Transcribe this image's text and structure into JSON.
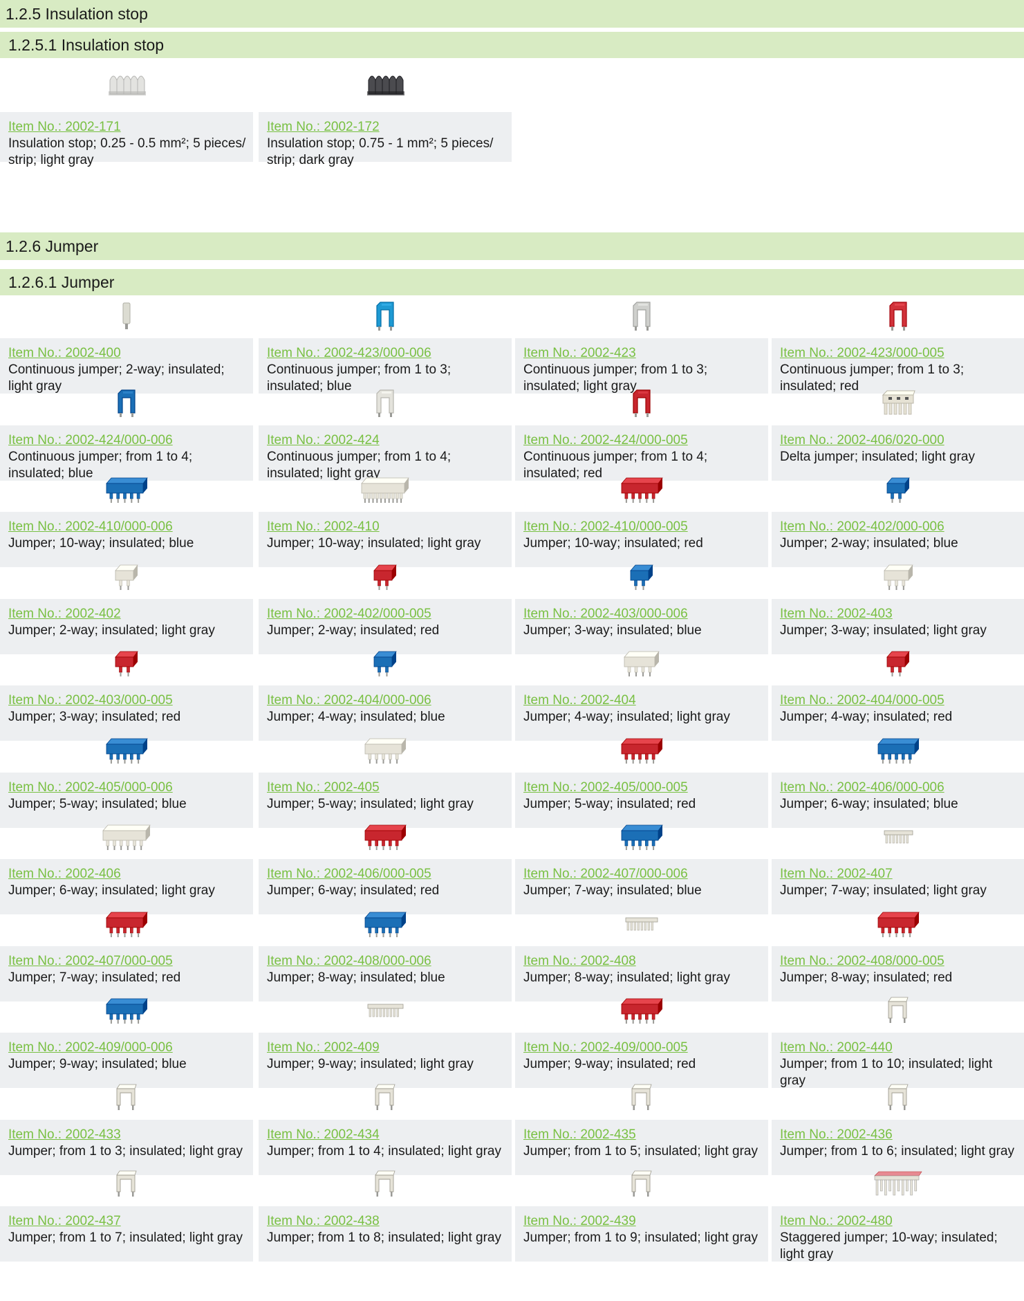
{
  "sections": {
    "s125": "1.2.5 Insulation stop",
    "s1251": "1.2.5.1 Insulation stop",
    "s126": "1.2.6 Jumper",
    "s1261": "1.2.6.1 Jumper"
  },
  "insulation_items": [
    {
      "item": "Item No.: 2002-171",
      "desc": "Insulation stop; 0.25 - 0.5 mm²; 5 pieces/ strip; light gray",
      "color": "#e3e3e0",
      "kind": "stop"
    },
    {
      "item": "Item No.: 2002-172",
      "desc": "Insulation stop; 0.75 - 1 mm²; 5 pieces/ strip; dark gray",
      "color": "#4b4b4f",
      "kind": "stop"
    }
  ],
  "jumper_items": [
    {
      "item": "Item No.: 2002-400",
      "desc": "Continuous jumper; 2-way; insulated; light gray",
      "color": "#dcdcd2",
      "kind": "single"
    },
    {
      "item": "Item No.: 2002-423/000-006",
      "desc": "Continuous jumper; from 1 to 3; insulated; blue",
      "color": "#1e9ad3",
      "kind": "cont"
    },
    {
      "item": "Item No.: 2002-423",
      "desc": "Continuous jumper; from 1 to 3; insulated; light gray",
      "color": "#cfd0cd",
      "kind": "cont"
    },
    {
      "item": "Item No.: 2002-423/000-005",
      "desc": "Continuous jumper; from 1 to 3; insulated; red",
      "color": "#d1323a",
      "kind": "cont"
    },
    {
      "item": "Item No.: 2002-424/000-006",
      "desc": "Continuous jumper; from 1 to 4; insulated; blue",
      "color": "#1b6fb6",
      "kind": "cont2"
    },
    {
      "item": "Item No.: 2002-424",
      "desc": "Continuous jumper; from 1 to 4; insulated; light gray",
      "color": "#e4e3dc",
      "kind": "cont2"
    },
    {
      "item": "Item No.: 2002-424/000-005",
      "desc": "Continuous jumper; from 1 to 4; insulated; red",
      "color": "#c8262e",
      "kind": "cont2"
    },
    {
      "item": "Item No.: 2002-406/020-000",
      "desc": "Delta jumper; insulated; light gray",
      "color": "#e6e2d4",
      "kind": "delta"
    },
    {
      "item": "Item No.: 2002-410/000-006",
      "desc": "Jumper; 10-way; insulated; blue",
      "color": "#1b6fb6",
      "kind": "multi",
      "n": 5
    },
    {
      "item": "Item No.: 2002-410",
      "desc": "Jumper; 10-way; insulated; light gray",
      "color": "#e6e3d8",
      "kind": "multi",
      "n": 10
    },
    {
      "item": "Item No.: 2002-410/000-005",
      "desc": "Jumper; 10-way; insulated; red",
      "color": "#c8262e",
      "kind": "multi",
      "n": 5
    },
    {
      "item": "Item No.: 2002-402/000-006",
      "desc": "Jumper; 2-way; insulated; blue",
      "color": "#1b6fb6",
      "kind": "multi",
      "n": 2
    },
    {
      "item": "Item No.: 2002-402",
      "desc": "Jumper; 2-way; insulated; light gray",
      "color": "#e6e3d8",
      "kind": "multi",
      "n": 2
    },
    {
      "item": "Item No.: 2002-402/000-005",
      "desc": "Jumper; 2-way; insulated; red",
      "color": "#c8262e",
      "kind": "multi",
      "n": 2
    },
    {
      "item": "Item No.: 2002-403/000-006",
      "desc": "Jumper; 3-way; insulated; blue",
      "color": "#1b6fb6",
      "kind": "multi",
      "n": 2
    },
    {
      "item": "Item No.: 2002-403",
      "desc": "Jumper; 3-way; insulated; light gray",
      "color": "#e6e3d8",
      "kind": "multi",
      "n": 3
    },
    {
      "item": "Item No.: 2002-403/000-005",
      "desc": "Jumper; 3-way; insulated; red",
      "color": "#c8262e",
      "kind": "multi",
      "n": 2
    },
    {
      "item": "Item No.: 2002-404/000-006",
      "desc": "Jumper; 4-way; insulated; blue",
      "color": "#1b6fb6",
      "kind": "multi",
      "n": 2
    },
    {
      "item": "Item No.: 2002-404",
      "desc": "Jumper; 4-way; insulated; light gray",
      "color": "#e6e3d8",
      "kind": "multi",
      "n": 4
    },
    {
      "item": "Item No.: 2002-404/000-005",
      "desc": "Jumper; 4-way; insulated; red",
      "color": "#c8262e",
      "kind": "multi",
      "n": 2
    },
    {
      "item": "Item No.: 2002-405/000-006",
      "desc": "Jumper; 5-way; insulated; blue",
      "color": "#1b6fb6",
      "kind": "multi",
      "n": 5
    },
    {
      "item": "Item No.: 2002-405",
      "desc": "Jumper; 5-way; insulated; light gray",
      "color": "#e6e3d8",
      "kind": "multi",
      "n": 5
    },
    {
      "item": "Item No.: 2002-405/000-005",
      "desc": "Jumper; 5-way; insulated; red",
      "color": "#c8262e",
      "kind": "multi",
      "n": 5
    },
    {
      "item": "Item No.: 2002-406/000-006",
      "desc": "Jumper; 6-way; insulated; blue",
      "color": "#1b6fb6",
      "kind": "multi",
      "n": 5
    },
    {
      "item": "Item No.: 2002-406",
      "desc": "Jumper; 6-way; insulated; light gray",
      "color": "#e6e3d8",
      "kind": "multi",
      "n": 6
    },
    {
      "item": "Item No.: 2002-406/000-005",
      "desc": "Jumper; 6-way; insulated; red",
      "color": "#c8262e",
      "kind": "multi",
      "n": 5
    },
    {
      "item": "Item No.: 2002-407/000-006",
      "desc": "Jumper; 7-way; insulated; blue",
      "color": "#1b6fb6",
      "kind": "multi",
      "n": 5
    },
    {
      "item": "Item No.: 2002-407",
      "desc": "Jumper; 7-way; insulated; light gray",
      "color": "#e6e3d8",
      "kind": "comb",
      "n": 7
    },
    {
      "item": "Item No.: 2002-407/000-005",
      "desc": "Jumper; 7-way; insulated; red",
      "color": "#c8262e",
      "kind": "multi",
      "n": 5
    },
    {
      "item": "Item No.: 2002-408/000-006",
      "desc": "Jumper; 8-way; insulated; blue",
      "color": "#1b6fb6",
      "kind": "multi",
      "n": 5
    },
    {
      "item": "Item No.: 2002-408",
      "desc": "Jumper; 8-way; insulated; light gray",
      "color": "#e6e3d8",
      "kind": "comb",
      "n": 8
    },
    {
      "item": "Item No.: 2002-408/000-005",
      "desc": "Jumper; 8-way; insulated; red",
      "color": "#c8262e",
      "kind": "multi",
      "n": 5
    },
    {
      "item": "Item No.: 2002-409/000-006",
      "desc": "Jumper; 9-way; insulated; blue",
      "color": "#1b6fb6",
      "kind": "multi",
      "n": 5
    },
    {
      "item": "Item No.: 2002-409",
      "desc": "Jumper; 9-way; insulated; light gray",
      "color": "#e6e3d8",
      "kind": "comb",
      "n": 9
    },
    {
      "item": "Item No.: 2002-409/000-005",
      "desc": "Jumper; 9-way; insulated; red",
      "color": "#c8262e",
      "kind": "multi",
      "n": 5
    },
    {
      "item": "Item No.: 2002-440",
      "desc": "Jumper; from 1 to 10; insulated; light gray",
      "color": "#e6e3d8",
      "kind": "bridge"
    },
    {
      "item": "Item No.: 2002-433",
      "desc": "Jumper; from 1 to 3; insulated; light gray",
      "color": "#e6e3d8",
      "kind": "bridge"
    },
    {
      "item": "Item No.: 2002-434",
      "desc": "Jumper; from 1 to 4; insulated; light gray",
      "color": "#e6e3d8",
      "kind": "bridge"
    },
    {
      "item": "Item No.: 2002-435",
      "desc": "Jumper; from 1 to 5; insulated; light gray",
      "color": "#e6e3d8",
      "kind": "bridge"
    },
    {
      "item": "Item No.: 2002-436",
      "desc": "Jumper; from 1 to 6; insulated; light gray",
      "color": "#e6e3d8",
      "kind": "bridge"
    },
    {
      "item": "Item No.: 2002-437",
      "desc": "Jumper; from 1 to 7; insulated; light gray",
      "color": "#e6e3d8",
      "kind": "bridge"
    },
    {
      "item": "Item No.: 2002-438",
      "desc": "Jumper; from 1 to 8; insulated; light gray",
      "color": "#e6e3d8",
      "kind": "bridge"
    },
    {
      "item": "Item No.: 2002-439",
      "desc": "Jumper; from 1 to 9; insulated; light gray",
      "color": "#e6e3d8",
      "kind": "bridge"
    },
    {
      "item": "Item No.: 2002-480",
      "desc": "Staggered jumper; 10-way; insulated; light gray",
      "color": "#e6e3d8",
      "kind": "stagger"
    }
  ]
}
